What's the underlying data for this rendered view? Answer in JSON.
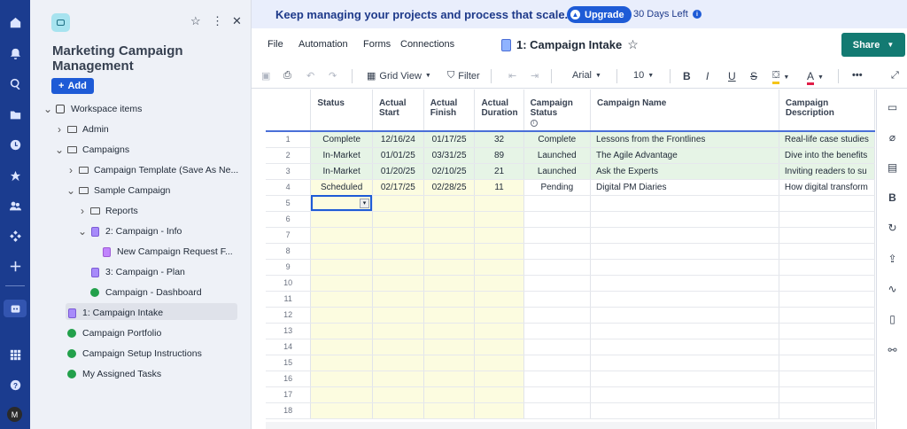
{
  "rail": {
    "icons": [
      "home-icon",
      "bell-icon",
      "search-icon",
      "folder-icon",
      "clock-icon",
      "star-icon",
      "people-icon",
      "apps-icon",
      "plus-icon",
      "solutions-icon",
      "grid-icon",
      "help-icon"
    ],
    "avatar_initial": "M"
  },
  "sidebar": {
    "workspace_title": "Marketing Campaign Management",
    "add_label": "Add",
    "tree": [
      {
        "label": "Workspace items",
        "type": "workspace",
        "caret": "down",
        "indent": 0
      },
      {
        "label": "Admin",
        "type": "folder",
        "caret": "right",
        "indent": 1
      },
      {
        "label": "Campaigns",
        "type": "folder",
        "caret": "down",
        "indent": 1
      },
      {
        "label": "Campaign Template (Save As Ne...",
        "type": "folder",
        "caret": "right",
        "indent": 2
      },
      {
        "label": "Sample Campaign",
        "type": "folder",
        "caret": "down",
        "indent": 2
      },
      {
        "label": "Reports",
        "type": "folder",
        "caret": "right",
        "indent": 3
      },
      {
        "label": "2: Campaign - Info",
        "type": "sheet",
        "caret": "down",
        "indent": 3
      },
      {
        "label": "New Campaign Request F...",
        "type": "report",
        "caret": "",
        "indent": 4
      },
      {
        "label": "3: Campaign - Plan",
        "type": "sheet",
        "caret": "",
        "indent": 3
      },
      {
        "label": "Campaign - Dashboard",
        "type": "dashboard",
        "caret": "",
        "indent": 3
      },
      {
        "label": "1: Campaign Intake",
        "type": "sheet",
        "caret": "",
        "indent": 1
      },
      {
        "label": "Campaign Portfolio",
        "type": "dashboard",
        "caret": "",
        "indent": 1
      },
      {
        "label": "Campaign Setup Instructions",
        "type": "dashboard",
        "caret": "",
        "indent": 1
      },
      {
        "label": "My Assigned Tasks",
        "type": "dashboard",
        "caret": "",
        "indent": 1
      }
    ]
  },
  "banner": {
    "message": "Keep managing your projects and process that scale.",
    "upgrade_label": "Upgrade",
    "days_left": "30 Days Left"
  },
  "menu": {
    "file": "File",
    "automation": "Automation",
    "forms": "Forms",
    "connections": "Connections",
    "sheet_title": "1: Campaign Intake",
    "share_label": "Share"
  },
  "toolbar": {
    "view_label": "Grid View",
    "filter_label": "Filter",
    "font": "Arial",
    "font_size": "10"
  },
  "grid": {
    "columns": [
      {
        "label": "Status"
      },
      {
        "label": "Actual Start"
      },
      {
        "label": "Actual Finish"
      },
      {
        "label": "Actual Duration"
      },
      {
        "label": "Campaign Status"
      },
      {
        "label": "Campaign Name"
      },
      {
        "label": "Campaign Description"
      }
    ],
    "rows": [
      [
        "1",
        "Complete",
        "12/16/24",
        "01/17/25",
        "32",
        "Complete",
        "Lessons from the Frontlines",
        "Real-life case studies"
      ],
      [
        "2",
        "In-Market",
        "01/01/25",
        "03/31/25",
        "89",
        "Launched",
        "The Agile Advantage",
        "Dive into the benefits"
      ],
      [
        "3",
        "In-Market",
        "01/20/25",
        "02/10/25",
        "21",
        "Launched",
        "Ask the Experts",
        "Inviting readers to su"
      ],
      [
        "4",
        "Scheduled",
        "02/17/25",
        "02/28/25",
        "11",
        "Pending",
        "Digital PM Diaries",
        "How digital transform"
      ],
      [
        "5",
        "",
        "",
        "",
        "",
        "",
        "",
        ""
      ],
      [
        "6",
        "",
        "",
        "",
        "",
        "",
        "",
        ""
      ],
      [
        "7",
        "",
        "",
        "",
        "",
        "",
        "",
        ""
      ],
      [
        "8",
        "",
        "",
        "",
        "",
        "",
        "",
        ""
      ],
      [
        "9",
        "",
        "",
        "",
        "",
        "",
        "",
        ""
      ],
      [
        "10",
        "",
        "",
        "",
        "",
        "",
        "",
        ""
      ],
      [
        "11",
        "",
        "",
        "",
        "",
        "",
        "",
        ""
      ],
      [
        "12",
        "",
        "",
        "",
        "",
        "",
        "",
        ""
      ],
      [
        "13",
        "",
        "",
        "",
        "",
        "",
        "",
        ""
      ],
      [
        "14",
        "",
        "",
        "",
        "",
        "",
        "",
        ""
      ],
      [
        "15",
        "",
        "",
        "",
        "",
        "",
        "",
        ""
      ],
      [
        "16",
        "",
        "",
        "",
        "",
        "",
        "",
        ""
      ],
      [
        "17",
        "",
        "",
        "",
        "",
        "",
        "",
        ""
      ],
      [
        "18",
        "",
        "",
        "",
        "",
        "",
        "",
        ""
      ]
    ]
  },
  "right_panel": {
    "icons": [
      "comment-icon",
      "attachment-icon",
      "proofing-icon",
      "brandfolder-icon",
      "activity-log-icon",
      "publish-icon",
      "summary-icon",
      "form-icon",
      "connection-icon"
    ]
  }
}
